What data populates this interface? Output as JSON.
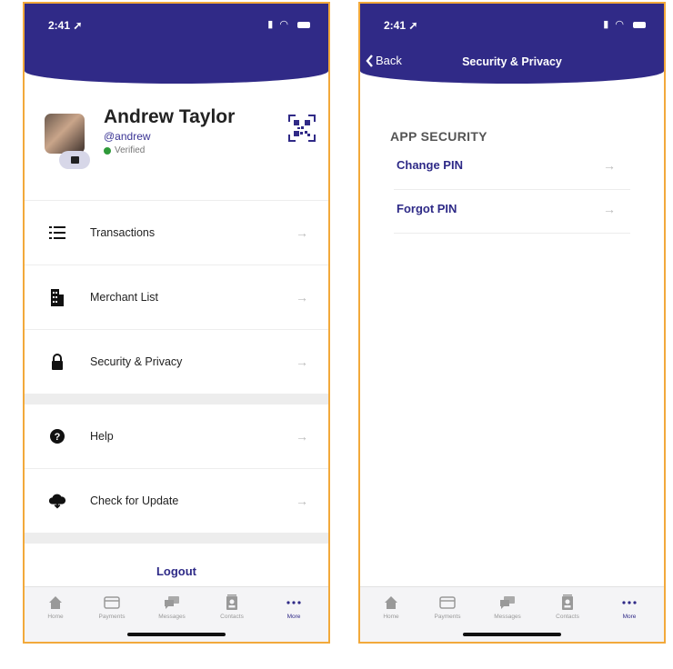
{
  "colors": {
    "brand": "#302a87",
    "frame": "#f2a93b",
    "verified": "#2f9a3a"
  },
  "status": {
    "time": "2:41"
  },
  "profile": {
    "name": "Andrew Taylor",
    "handle": "@andrew",
    "verified": "Verified"
  },
  "menu": {
    "items": [
      {
        "label": "Transactions",
        "icon": "list-icon"
      },
      {
        "label": "Merchant List",
        "icon": "building-icon"
      },
      {
        "label": "Security & Privacy",
        "icon": "lock-icon"
      },
      {
        "label": "Help",
        "icon": "question-icon"
      },
      {
        "label": "Check for Update",
        "icon": "cloud-download-icon"
      }
    ],
    "logout": "Logout"
  },
  "tabs": [
    {
      "label": "Home",
      "icon": "home-icon"
    },
    {
      "label": "Payments",
      "icon": "card-icon"
    },
    {
      "label": "Messages",
      "icon": "chat-icon"
    },
    {
      "label": "Contacts",
      "icon": "contacts-icon"
    },
    {
      "label": "More",
      "icon": "more-icon",
      "active": true
    }
  ],
  "security_screen": {
    "back": "Back",
    "title": "Security & Privacy",
    "section": "APP SECURITY",
    "items": [
      {
        "label": "Change PIN"
      },
      {
        "label": "Forgot PIN"
      }
    ]
  },
  "arrow_glyph": "→"
}
